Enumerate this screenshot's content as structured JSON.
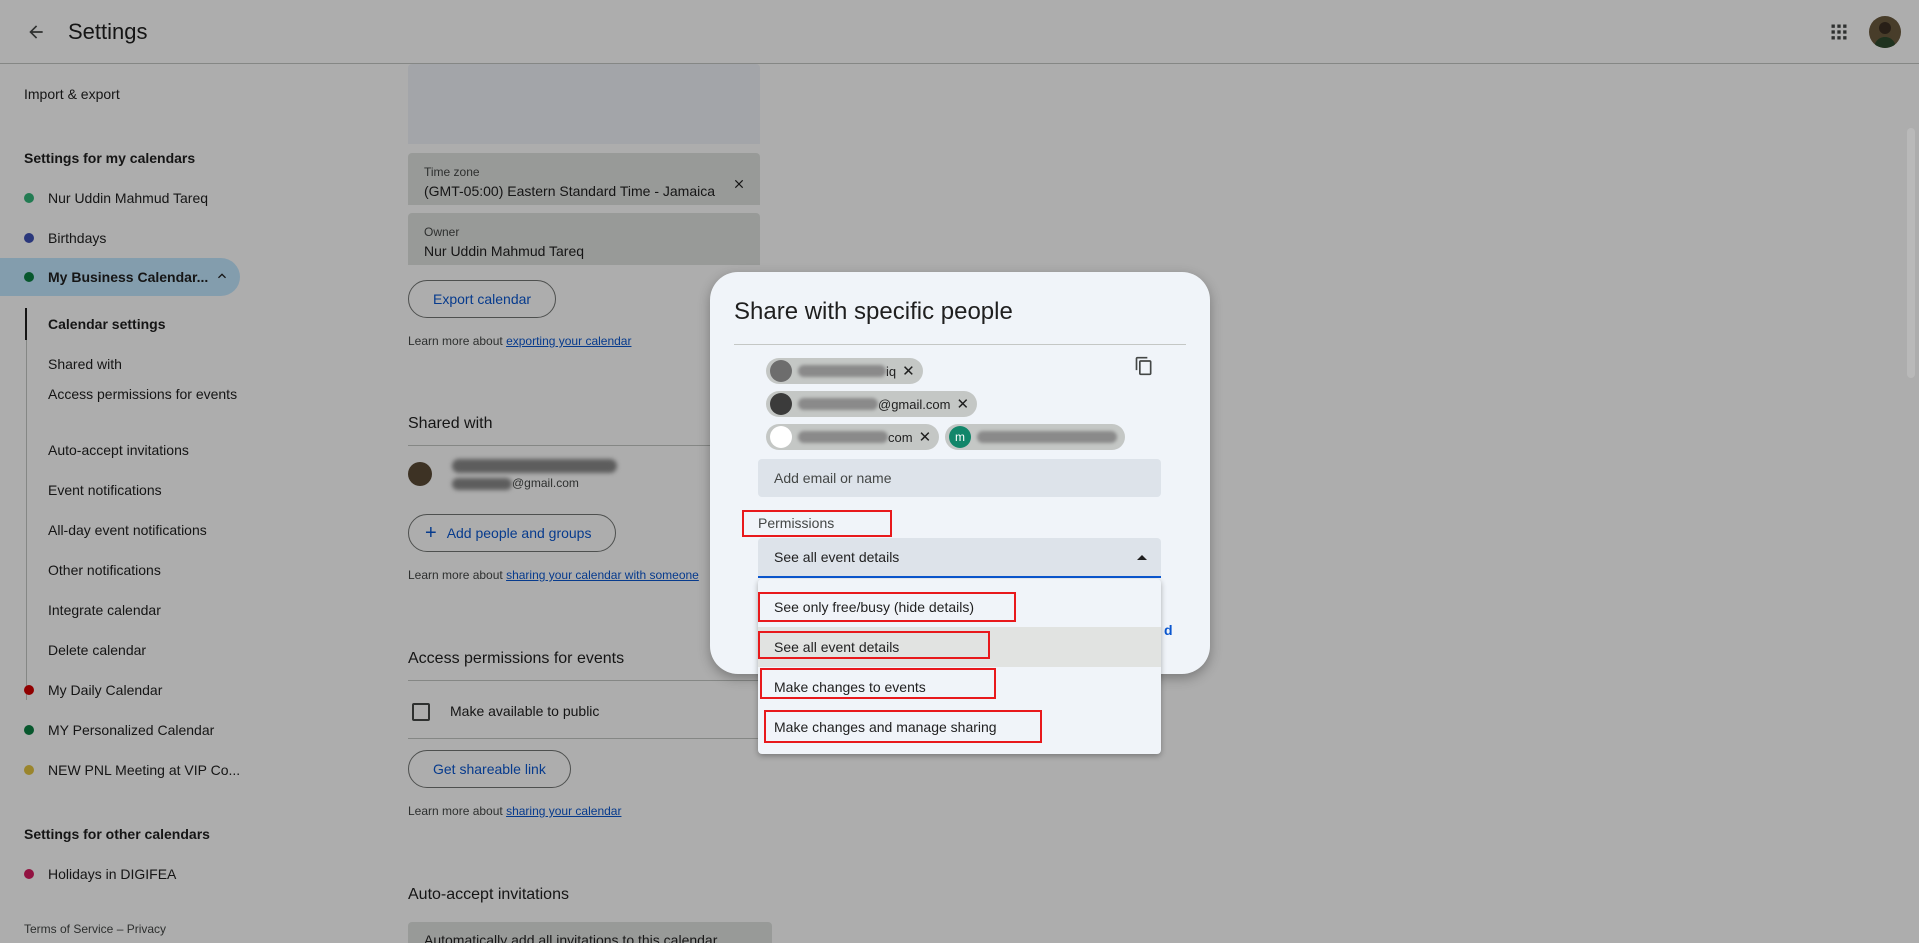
{
  "header": {
    "title": "Settings"
  },
  "sidebar": {
    "import_export": "Import & export",
    "my_calendars_title": "Settings for my calendars",
    "calendars": [
      {
        "name": "Nur Uddin Mahmud Tareq",
        "color": "#33b679"
      },
      {
        "name": "Birthdays",
        "color": "#3f51b5"
      }
    ],
    "active_calendar": "My Business Calendar...",
    "sub_items": [
      "Calendar settings",
      "Shared with",
      "Access permissions for events",
      "Auto-accept invitations",
      "Event notifications",
      "All-day event notifications",
      "Other notifications",
      "Integrate calendar",
      "Delete calendar"
    ],
    "more_calendars": [
      {
        "name": "My Daily Calendar",
        "color": "#d50000"
      },
      {
        "name": "MY Personalized Calendar",
        "color": "#0b8043"
      },
      {
        "name": "NEW PNL Meeting at VIP Co...",
        "color": "#e4c441"
      }
    ],
    "other_calendars_title": "Settings for other calendars",
    "other_calendars": [
      {
        "name": "Holidays in DIGIFEA",
        "color": "#d81b60"
      }
    ],
    "footer": "Terms of Service – Privacy"
  },
  "main": {
    "timezone_label": "Time zone",
    "timezone_value": "(GMT-05:00) Eastern Standard Time - Jamaica",
    "owner_label": "Owner",
    "owner_value": "Nur Uddin Mahmud Tareq",
    "export_button": "Export calendar",
    "export_learn_prefix": "Learn more about ",
    "export_learn_link": "exporting your calendar",
    "shared_title": "Shared with",
    "shared_email_suffix": "@gmail.com",
    "add_people_button": "Add people and groups",
    "share_learn_prefix": "Learn more about ",
    "share_learn_link": "sharing your calendar with someone",
    "access_title": "Access permissions for events",
    "public_label": "Make available to public",
    "shareable_button": "Get shareable link",
    "public_learn_prefix": "Learn more about ",
    "public_learn_link": "sharing your calendar",
    "auto_accept_title": "Auto-accept invitations",
    "auto_accept_value": "Automatically add all invitations to this calendar"
  },
  "dialog": {
    "title": "Share with specific people",
    "chips": [
      {
        "visible_text": "iq"
      },
      {
        "visible_text": "@gmail.com"
      },
      {
        "visible_text": "com"
      },
      {
        "visible_text": "",
        "initial": "m"
      }
    ],
    "add_placeholder": "Add email or name",
    "permissions_label": "Permissions",
    "permissions_selected": "See all event details",
    "link_fragment": "d",
    "options": [
      "See only free/busy (hide details)",
      "See all event details",
      "Make changes to events",
      "Make changes and manage sharing"
    ],
    "selected_index": 1
  },
  "colors": {
    "accent": "#0b57d0",
    "highlight": "#e8191c",
    "active_bg": "#c2e7ff"
  }
}
